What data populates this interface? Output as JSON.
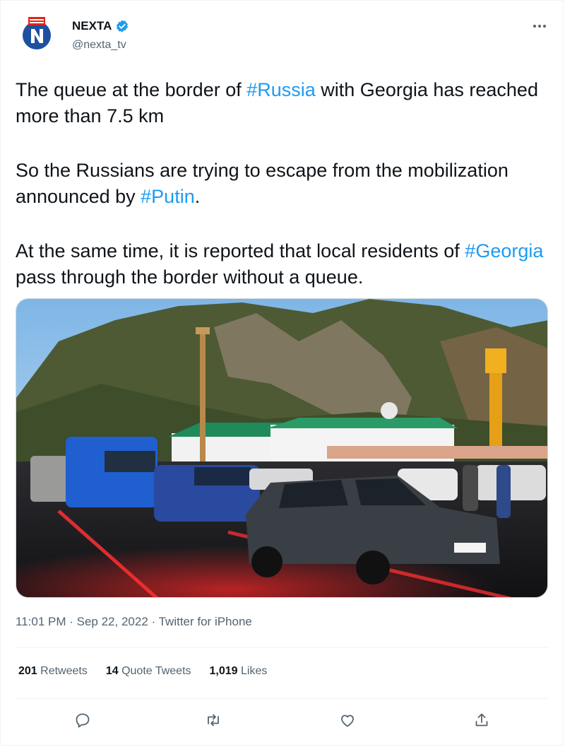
{
  "user": {
    "display_name": "NEXTA",
    "handle": "@nexta_tv",
    "avatar_letter": "N",
    "verified": true
  },
  "tweet": {
    "p1_before": "The queue at the border of ",
    "p1_tag": "#Russia",
    "p1_after": " with Georgia has reached more than 7.5 km",
    "p2_before": "So the Russians are trying to escape from the mobilization announced by ",
    "p2_tag": "#Putin",
    "p2_after": ".",
    "p3_before": "At the same time, it is reported that local residents of ",
    "p3_tag": "#Georgia",
    "p3_after": " pass through the border without a queue."
  },
  "meta": {
    "time": "11:01 PM",
    "separator": " · ",
    "date": "Sep 22, 2022",
    "source": "Twitter for iPhone"
  },
  "stats": {
    "retweets_count": "201",
    "retweets_label": " Retweets",
    "quotes_count": "14",
    "quotes_label": " Quote Tweets",
    "likes_count": "1,019",
    "likes_label": " Likes"
  },
  "actions": {
    "icons": [
      "reply-icon",
      "retweet-icon",
      "like-icon",
      "share-icon"
    ]
  },
  "colors": {
    "text": "#0f1419",
    "secondary": "#536471",
    "link": "#1d9bf0",
    "verified": "#1d9bf0",
    "brand_red": "#e2231a",
    "brand_blue": "#1e50a0"
  }
}
